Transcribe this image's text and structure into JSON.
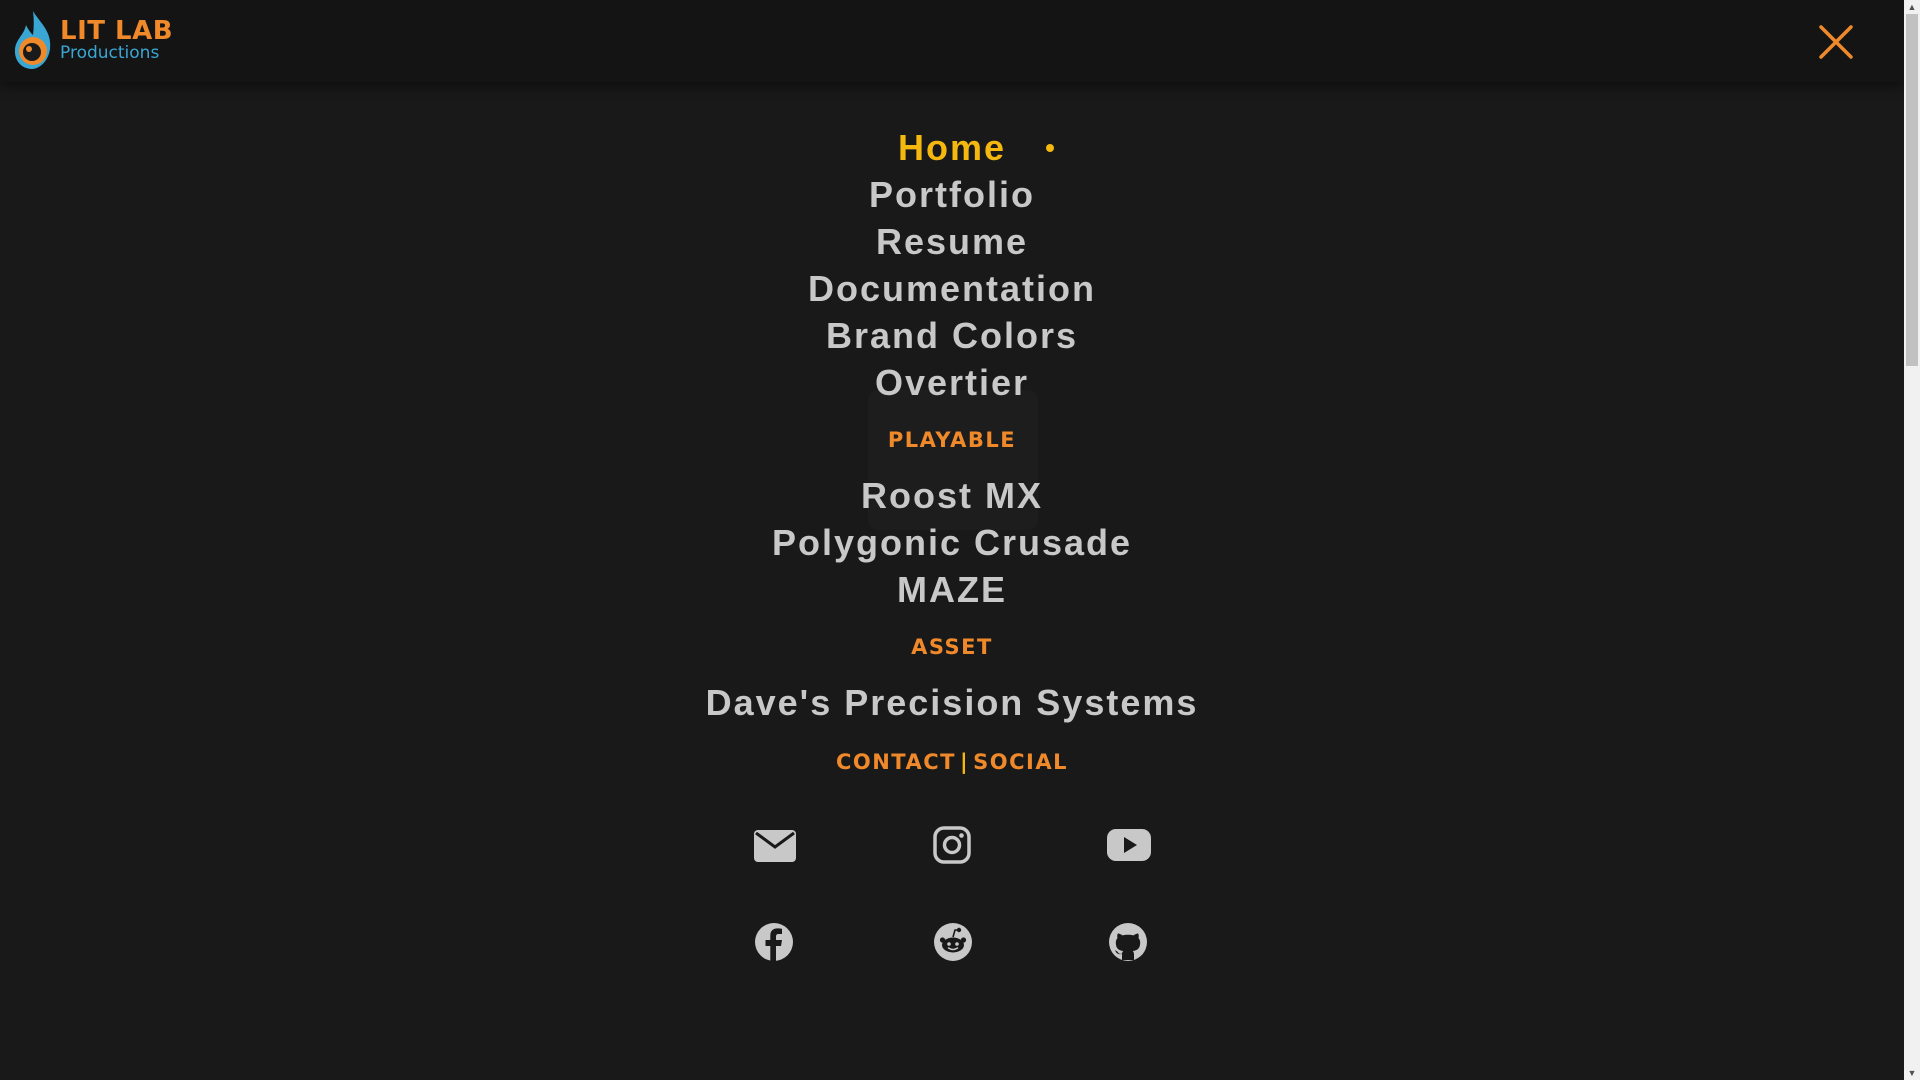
{
  "header": {
    "logo_line1": "LIT LAB",
    "logo_line2": "Productions",
    "close_label": "close-icon"
  },
  "nav": {
    "items": [
      {
        "label": "Home",
        "active": true
      },
      {
        "label": "Portfolio"
      },
      {
        "label": "Resume"
      },
      {
        "label": "Documentation"
      },
      {
        "label": "Brand Colors"
      },
      {
        "label": "Overtier"
      }
    ],
    "playable_label": "PLAYABLE",
    "playable_items": [
      "Roost MX",
      "Polygonic Crusade",
      "MAZE"
    ],
    "asset_label": "ASSET",
    "asset_items": [
      "Dave's Precision Systems"
    ],
    "contact_label": "CONTACT",
    "separator": "|",
    "social_label": "SOCIAL"
  },
  "social_icons": [
    "email-icon",
    "instagram-icon",
    "youtube-icon",
    "facebook-icon",
    "reddit-icon",
    "github-icon"
  ],
  "colors": {
    "background": "#191919",
    "header": "#141414",
    "accent_orange": "#f0892a",
    "accent_yellow": "#f5b80f",
    "nav_text": "#c8c8c8",
    "logo_blue": "#3aa6d4"
  }
}
